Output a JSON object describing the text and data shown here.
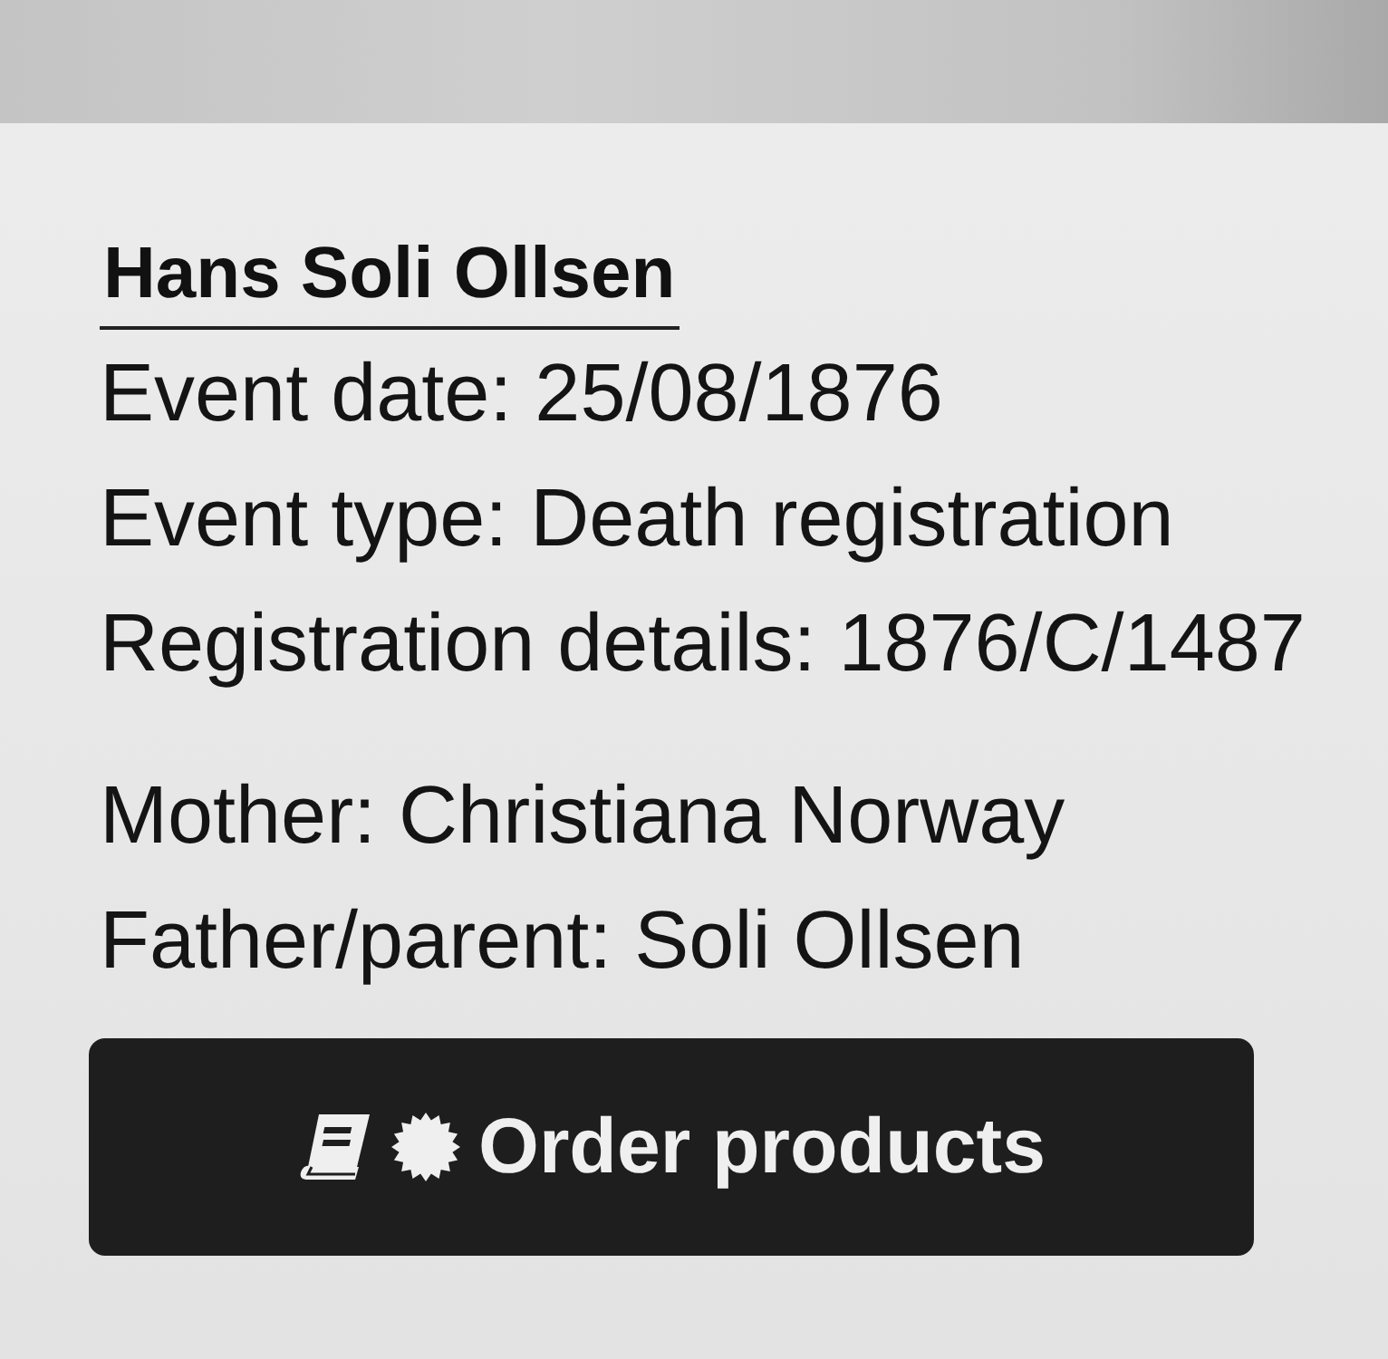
{
  "record": {
    "name": "Hans Soli Ollsen",
    "details": [
      "Event date: 25/08/1876",
      "Event type: Death registration",
      "Registration details: 1876/C/1487"
    ],
    "parents": [
      "Mother: Christiana Norway",
      "Father/parent: Soli Ollsen"
    ],
    "button": {
      "label": "Order products"
    }
  }
}
